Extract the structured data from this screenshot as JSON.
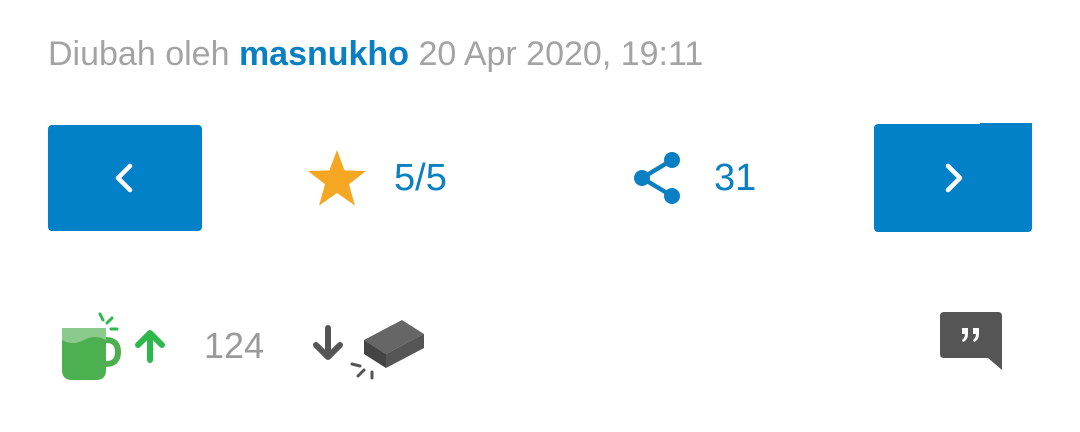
{
  "meta": {
    "prefix": "Diubah oleh",
    "author": "masnukho",
    "timestamp": "20 Apr 2020, 19:11"
  },
  "nav": {
    "prev_icon": "chevron-left-icon",
    "next_icon": "chevron-right-icon"
  },
  "rating": {
    "icon": "star-icon",
    "value": "5/5"
  },
  "share": {
    "icon": "share-icon",
    "count": "31"
  },
  "reactions": {
    "cendol_icon": "cendol-cup-upvote-icon",
    "cendol_count": "124",
    "bata_icon": "brick-downvote-icon"
  },
  "quote": {
    "icon": "quote-speech-bubble-icon"
  },
  "colors": {
    "accent_blue": "#0281c8",
    "link_blue": "#0a7fc2",
    "star_orange": "#f5a623",
    "muted_text": "#a3a3a3",
    "cendol_green": "#4caf50",
    "upvote_green": "#2db84b",
    "dark_gray": "#555555"
  }
}
